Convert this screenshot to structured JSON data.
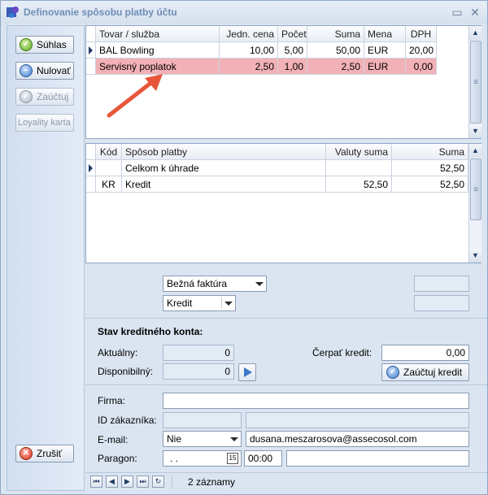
{
  "window": {
    "title": "Definovanie spôsobu platby účtu",
    "buttons": {
      "restore": "▭",
      "close": "✕"
    }
  },
  "actions": {
    "suhlas": "Súhlas",
    "nulovat": "Nulovať",
    "zauctuj": "Zaúčtuj",
    "loyalty": "Loyality karta",
    "zrusit": "Zrušiť"
  },
  "items_grid": {
    "columns": [
      "Tovar / služba",
      "Jedn. cena",
      "Počet",
      "Suma",
      "Mena",
      "DPH"
    ],
    "rows": [
      [
        "BAL Bowling",
        "10,00",
        "5,00",
        "50,00",
        "EUR",
        "20,00"
      ],
      [
        "Servisný poplatok",
        "2,50",
        "1,00",
        "2,50",
        "EUR",
        "0,00"
      ]
    ]
  },
  "payments_grid": {
    "columns": [
      "Kód",
      "Spôsob platby",
      "Valuty suma",
      "Suma"
    ],
    "rows": [
      [
        "",
        "Celkom k úhrade",
        "",
        "52,50"
      ],
      [
        "KR",
        "Kredit",
        "52,50",
        "52,50"
      ]
    ]
  },
  "invoice": {
    "type_value": "Bežná faktúra",
    "method_value": "Kredit"
  },
  "credit": {
    "heading": "Stav kreditného konta:",
    "aktualny_label": "Aktuálny:",
    "aktualny_value": "0",
    "disponibilny_label": "Disponibilný:",
    "disponibilny_value": "0",
    "cerpat_label": "Čerpať kredit:",
    "cerpat_value": "0,00",
    "zauctuj_kredit": "Zaúčtuj kredit"
  },
  "customer": {
    "firma_label": "Firma:",
    "id_label": "ID zákazníka:",
    "email_label": "E-mail:",
    "email_option": "Nie",
    "email_value": "dusana.meszarosova@assecosol.com",
    "paragon_label": "Paragon:",
    "paragon_date": ". .",
    "calendar_day": "15",
    "paragon_time": "00:00"
  },
  "navigator": {
    "status": "2 záznamy"
  },
  "colors": {
    "selected_row": "#f2b1b6",
    "arrow": "#e8563a"
  }
}
